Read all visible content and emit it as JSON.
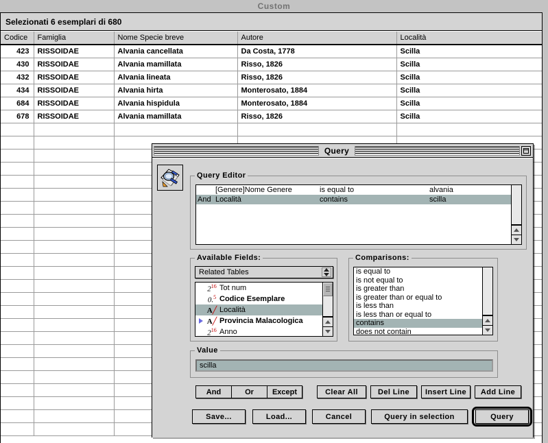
{
  "window": {
    "title": "Custom",
    "status": "Selezionati 6 esemplari di 680"
  },
  "table": {
    "columns": [
      "Codice",
      "Famiglia",
      "Nome Specie breve",
      "Autore",
      "Località"
    ],
    "rows": [
      [
        "423",
        "RISSOIDAE",
        "Alvania cancellata",
        "Da Costa, 1778",
        "Scilla"
      ],
      [
        "430",
        "RISSOIDAE",
        "Alvania mamillata",
        "Risso, 1826",
        "Scilla"
      ],
      [
        "432",
        "RISSOIDAE",
        "Alvania lineata",
        "Risso, 1826",
        "Scilla"
      ],
      [
        "434",
        "RISSOIDAE",
        "Alvania hirta",
        "Monterosato, 1884",
        "Scilla"
      ],
      [
        "684",
        "RISSOIDAE",
        "Alvania hispidula",
        "Monterosato, 1884",
        "Scilla"
      ],
      [
        "678",
        "RISSOIDAE",
        "Alvania mamillata",
        "Risso, 1826",
        "Scilla"
      ]
    ],
    "empty_row_count": 24
  },
  "dialog": {
    "title": "Query",
    "icon": "query-document-magnifier-icon",
    "collapse_box": "collapse-box-icon",
    "editor": {
      "legend": "Query Editor",
      "rows": [
        {
          "conjunction": "",
          "field": "[Genere]Nome Genere",
          "comparison": "is equal to",
          "value": "alvania",
          "selected": false
        },
        {
          "conjunction": "And",
          "field": "Località",
          "comparison": "contains",
          "value": "scilla",
          "selected": true
        }
      ]
    },
    "available_fields": {
      "legend": "Available Fields:",
      "source_menu": "Related Tables",
      "items": [
        {
          "label": "Tot num",
          "icon": "integer-field-icon",
          "bold": false,
          "expandable": false,
          "selected": false
        },
        {
          "label": "Codice Esemplare",
          "icon": "real-field-icon",
          "bold": true,
          "expandable": false,
          "selected": false
        },
        {
          "label": "Località",
          "icon": "text-field-icon",
          "bold": false,
          "expandable": false,
          "selected": true
        },
        {
          "label": "Provincia Malacologica",
          "icon": "text-field-icon",
          "bold": true,
          "expandable": true,
          "selected": false
        },
        {
          "label": "Anno",
          "icon": "integer-field-icon",
          "bold": false,
          "expandable": false,
          "selected": false
        }
      ]
    },
    "comparisons": {
      "legend": "Comparisons:",
      "items": [
        {
          "label": "is equal to",
          "selected": false
        },
        {
          "label": "is not equal to",
          "selected": false
        },
        {
          "label": "is greater than",
          "selected": false
        },
        {
          "label": "is greater than or equal to",
          "selected": false
        },
        {
          "label": "is less than",
          "selected": false
        },
        {
          "label": "is less than or equal to",
          "selected": false
        },
        {
          "label": "contains",
          "selected": true
        },
        {
          "label": "does not contain",
          "selected": false
        }
      ]
    },
    "value": {
      "legend": "Value",
      "text": "scilla"
    },
    "operator_buttons": [
      "And",
      "Or",
      "Except"
    ],
    "line_buttons": [
      "Clear All",
      "Del Line",
      "Insert Line",
      "Add Line"
    ],
    "action_buttons": {
      "save": "Save...",
      "load": "Load...",
      "cancel": "Cancel",
      "query_in_selection": "Query in selection",
      "query": "Query"
    }
  },
  "colors": {
    "selection": "#a3b4b4",
    "chrome": "#d4d4d4",
    "field_icon_red": "#c00000",
    "disclosure_triangle": "#6a6ae0"
  }
}
